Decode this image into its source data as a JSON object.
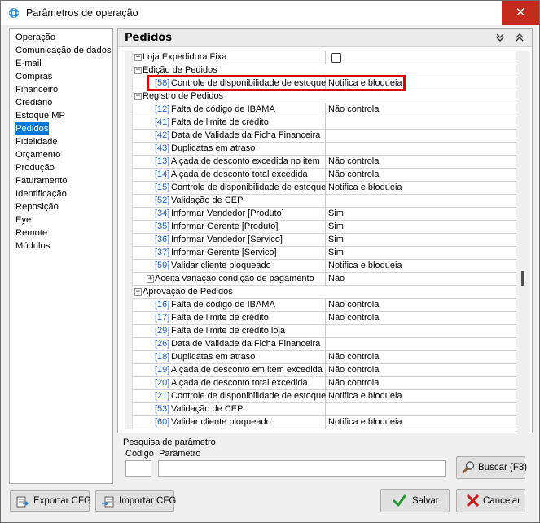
{
  "window": {
    "title": "Parâmetros de operação"
  },
  "sidebar": {
    "items": [
      {
        "label": "Operação"
      },
      {
        "label": "Comunicação de dados"
      },
      {
        "label": "E-mail"
      },
      {
        "label": "Compras"
      },
      {
        "label": "Financeiro"
      },
      {
        "label": "Crediário"
      },
      {
        "label": "Estoque MP"
      },
      {
        "label": "Pedidos",
        "selected": true
      },
      {
        "label": "Fidelidade"
      },
      {
        "label": "Orçamento"
      },
      {
        "label": "Produção"
      },
      {
        "label": "Faturamento"
      },
      {
        "label": "Identificação"
      },
      {
        "label": "Reposição"
      },
      {
        "label": "Eye"
      },
      {
        "label": "Remote"
      },
      {
        "label": "Módulos"
      }
    ]
  },
  "panel": {
    "title": "Pedidos",
    "rows": [
      {
        "kind": "group",
        "expander": "+",
        "text": "Loja Expedidora Fixa",
        "value_checkbox": true
      },
      {
        "kind": "group",
        "expander": "−",
        "text": "Edição de Pedidos"
      },
      {
        "kind": "param",
        "code": "[58]",
        "desc": "Controle de disponibilidade de estoque",
        "value": "Notifica e bloqueia"
      },
      {
        "kind": "group",
        "expander": "−",
        "text": "Registro de Pedidos"
      },
      {
        "kind": "param",
        "code": "[12]",
        "desc": "Falta de código de IBAMA",
        "value": "Não controla"
      },
      {
        "kind": "param",
        "code": "[41]",
        "desc": "Falta de limite de crédito",
        "value": ""
      },
      {
        "kind": "param",
        "code": "[42]",
        "desc": "Data de Validade da Ficha Financeira",
        "value": ""
      },
      {
        "kind": "param",
        "code": "[43]",
        "desc": "Duplicatas em atraso",
        "value": ""
      },
      {
        "kind": "param",
        "code": "[13]",
        "desc": "Alçada de desconto excedida no item",
        "value": "Não controla"
      },
      {
        "kind": "param",
        "code": "[14]",
        "desc": "Alçada de desconto total excedida",
        "value": "Não controla"
      },
      {
        "kind": "param",
        "code": "[15]",
        "desc": "Controle de disponibilidade de estoque",
        "value": "Notifica e bloqueia"
      },
      {
        "kind": "param",
        "code": "[52]",
        "desc": "Validação de CEP",
        "value": ""
      },
      {
        "kind": "param",
        "code": "[34]",
        "desc": "Informar Vendedor [Produto]",
        "value": "Sim"
      },
      {
        "kind": "param",
        "code": "[35]",
        "desc": "Informar Gerente [Produto]",
        "value": "Sim"
      },
      {
        "kind": "param",
        "code": "[36]",
        "desc": "Informar Vendedor [Servico]",
        "value": "Sim"
      },
      {
        "kind": "param",
        "code": "[37]",
        "desc": "Informar Gerente [Servico]",
        "value": "Sim"
      },
      {
        "kind": "param",
        "code": "[59]",
        "desc": "Validar cliente bloqueado",
        "value": "Notifica e bloqueia"
      },
      {
        "kind": "subgroup",
        "expander": "+",
        "text": "Aceita variação condição de pagamento",
        "value": "Não"
      },
      {
        "kind": "group",
        "expander": "−",
        "text": "Aprovação de Pedidos"
      },
      {
        "kind": "param",
        "code": "[16]",
        "desc": "Falta de código de IBAMA",
        "value": "Não controla"
      },
      {
        "kind": "param",
        "code": "[17]",
        "desc": "Falta de limite de crédito",
        "value": "Não controla"
      },
      {
        "kind": "param",
        "code": "[29]",
        "desc": "Falta de limite de crédito loja",
        "value": ""
      },
      {
        "kind": "param",
        "code": "[26]",
        "desc": "Data de Validade da Ficha Financeira",
        "value": ""
      },
      {
        "kind": "param",
        "code": "[18]",
        "desc": "Duplicatas em atraso",
        "value": "Não controla"
      },
      {
        "kind": "param",
        "code": "[19]",
        "desc": "Alçada de desconto em item excedida",
        "value": "Não controla"
      },
      {
        "kind": "param",
        "code": "[20]",
        "desc": "Alçada de desconto total excedida",
        "value": "Não controla"
      },
      {
        "kind": "param",
        "code": "[21]",
        "desc": "Controle de disponibilidade de estoque",
        "value": "Notifica e bloqueia"
      },
      {
        "kind": "param",
        "code": "[53]",
        "desc": "Validação de CEP",
        "value": ""
      },
      {
        "kind": "param",
        "code": "[60]",
        "desc": "Validar cliente bloqueado",
        "value": "Notifica e bloqueia"
      }
    ]
  },
  "search": {
    "legend": "Pesquisa de parâmetro",
    "code_label": "Código",
    "param_label": "Parâmetro",
    "code_value": "",
    "param_value": "",
    "button_label": "Buscar (F3)"
  },
  "footer": {
    "export_label": "Exportar CFG",
    "import_label": "Importar CFG",
    "save_label": "Salvar",
    "cancel_label": "Cancelar"
  },
  "colors": {
    "selection": "#0078d7",
    "param_code": "#1e5cb8",
    "highlight_border": "#e00000",
    "close_button": "#c42b1c"
  }
}
